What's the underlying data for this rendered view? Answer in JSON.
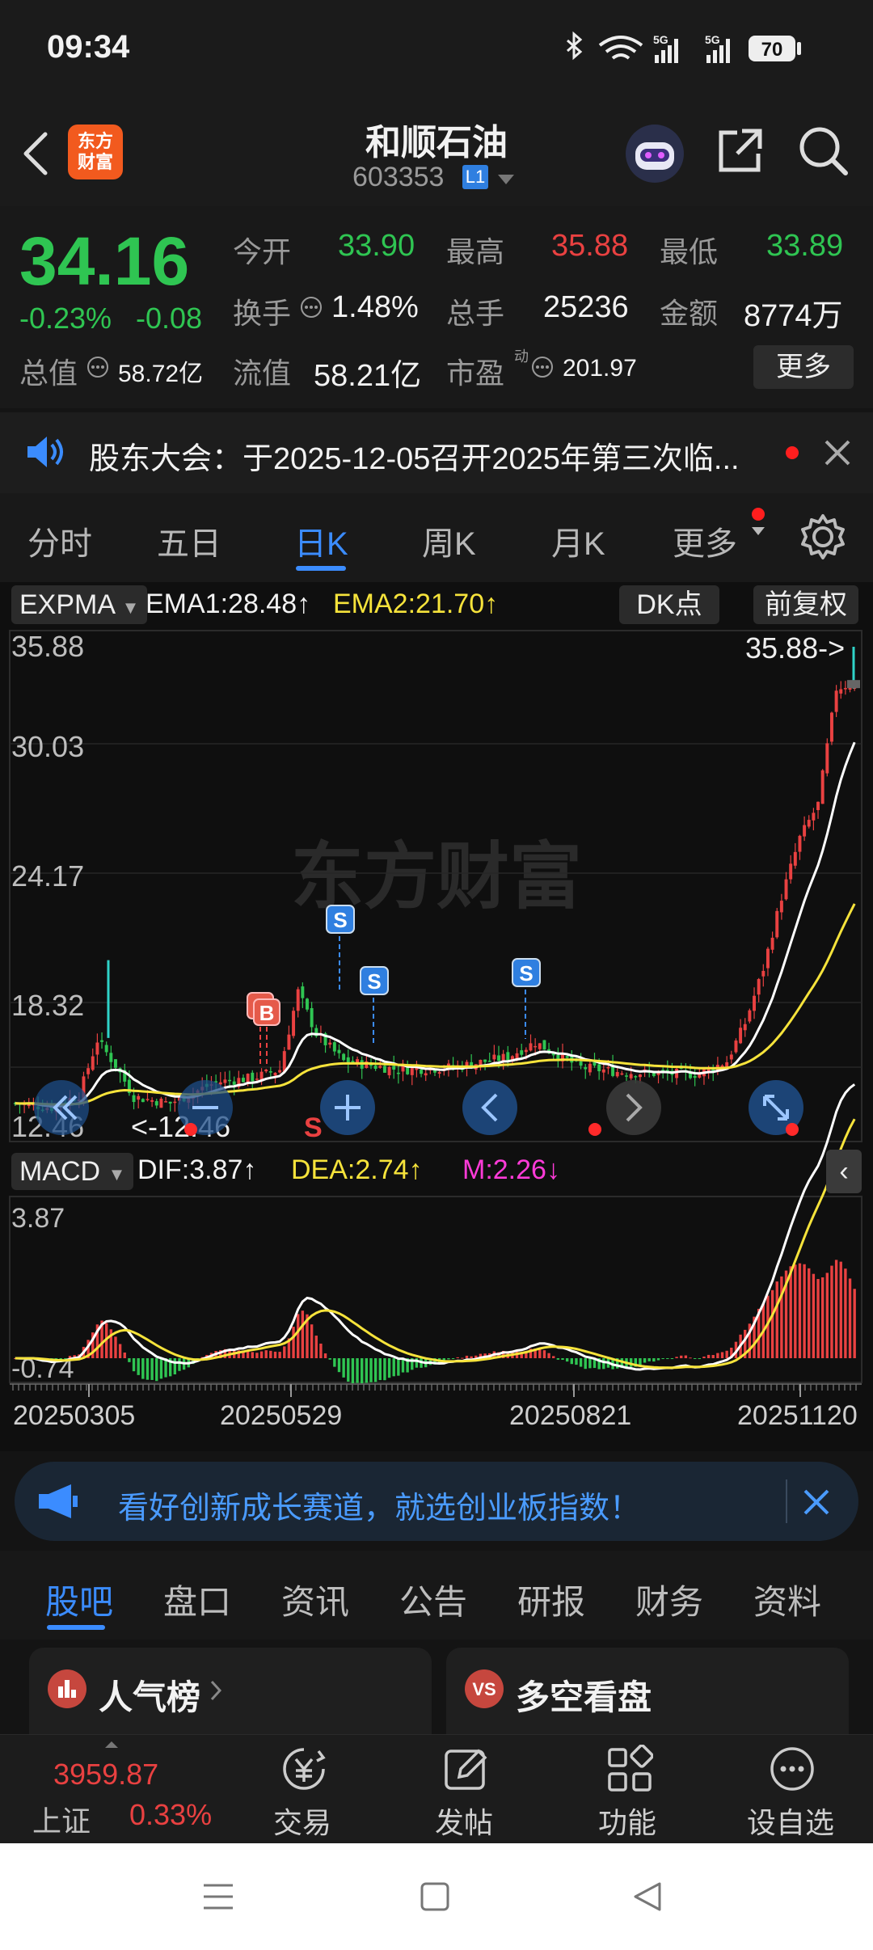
{
  "status_bar": {
    "time": "09:34",
    "battery": "70",
    "net1": "5G",
    "net2": "5G"
  },
  "header": {
    "brand_line1": "东方",
    "brand_line2": "财富",
    "title": "和顺石油",
    "code": "603353",
    "level_badge": "L1"
  },
  "quote": {
    "price": "34.16",
    "change_pct": "-0.23%",
    "change_amt": "-0.08",
    "open_label": "今开",
    "open": "33.90",
    "high_label": "最高",
    "high": "35.88",
    "low_label": "最低",
    "low": "33.89",
    "turnover_label": "换手",
    "turnover": "1.48%",
    "volume_label": "总手",
    "volume": "25236",
    "amount_label": "金额",
    "amount": "8774万",
    "mktcap_label": "总值",
    "mktcap": "58.72亿",
    "float_label": "流值",
    "float_cap": "58.21亿",
    "pe_label": "市盈",
    "pe_sup": "动",
    "pe": "201.97",
    "more_button": "更多"
  },
  "notice": {
    "text": "股东大会：于2025-12-05召开2025年第三次临..."
  },
  "period_tabs": [
    {
      "label": "分时"
    },
    {
      "label": "五日"
    },
    {
      "label": "日K"
    },
    {
      "label": "周K"
    },
    {
      "label": "月K"
    },
    {
      "label": "更多"
    }
  ],
  "indicator_bar": {
    "indicator": "EXPMA",
    "ema1": "EMA1:28.48",
    "ema2": "EMA2:21.70",
    "arrow": "↑",
    "dk_button": "DK点",
    "adjust_button": "前复权"
  },
  "kline": {
    "y_labels": [
      "35.88",
      "30.03",
      "24.17",
      "18.32",
      "12.46"
    ],
    "max_label": "35.88->",
    "min_label": "<-12.46",
    "watermark": "东方财富",
    "signals": {
      "sell": "S",
      "buy": "B"
    }
  },
  "macd_bar": {
    "indicator": "MACD",
    "dif": "DIF:3.87",
    "dea": "DEA:2.74",
    "m": "M:2.26",
    "up": "↑",
    "down": "↓",
    "y_top": "3.87",
    "y_bottom": "-0.74"
  },
  "dates": [
    "20250305",
    "20250529",
    "20250821",
    "20251120"
  ],
  "banner": {
    "text": "看好创新成长赛道，就选创业板指数！"
  },
  "sub_tabs": [
    {
      "label": "股吧"
    },
    {
      "label": "盘口"
    },
    {
      "label": "资讯"
    },
    {
      "label": "公告"
    },
    {
      "label": "研报"
    },
    {
      "label": "财务"
    },
    {
      "label": "资料"
    }
  ],
  "cards": {
    "left_title": "人气榜",
    "right_title": "多空看盘"
  },
  "bottom_bar": {
    "index_value": "3959.87",
    "index_name": "上证",
    "index_change": "0.33%",
    "trade": "交易",
    "post": "发帖",
    "functions": "功能",
    "watchlist": "设自选"
  },
  "colors": {
    "up": "#e94141",
    "down": "#2fc552",
    "accent": "#2f8cff",
    "ema2": "#f6e33b"
  }
}
